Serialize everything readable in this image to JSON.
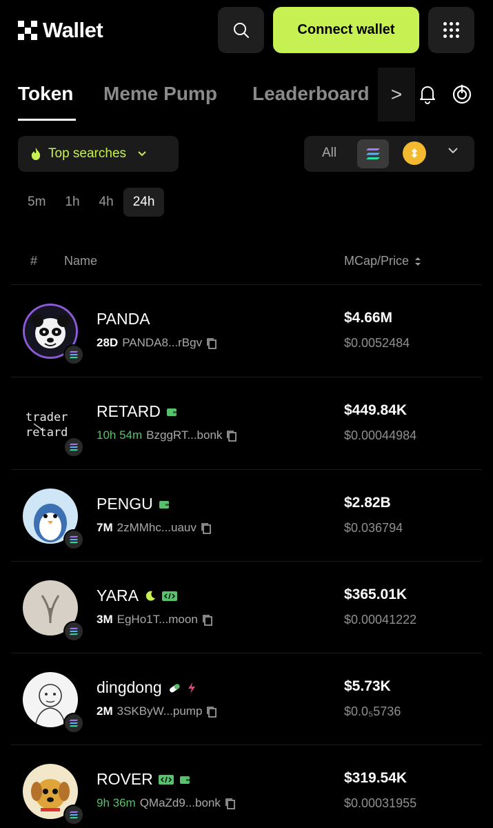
{
  "header": {
    "app_name": "Wallet",
    "connect_label": "Connect wallet",
    "icons": {
      "search": "search-icon",
      "menu": "grid-menu-icon"
    },
    "accent_color": "#c7f052"
  },
  "tabs": {
    "items": [
      {
        "label": "Token",
        "active": true
      },
      {
        "label": "Meme Pump",
        "active": false
      },
      {
        "label": "Leaderboard",
        "active": false
      }
    ],
    "more_label": ">"
  },
  "filters": {
    "top_searches_label": "Top searches",
    "chain_all_label": "All",
    "timeframes": [
      {
        "label": "5m",
        "active": false
      },
      {
        "label": "1h",
        "active": false
      },
      {
        "label": "4h",
        "active": false
      },
      {
        "label": "24h",
        "active": true
      }
    ]
  },
  "table": {
    "col_rank": "#",
    "col_name": "Name",
    "col_mcap": "MCap/Price",
    "rows": [
      {
        "name": "PANDA",
        "age": "28D",
        "address": "PANDA8...rBgv",
        "mcap": "$4.66M",
        "price": "$0.0052484",
        "age_green": false,
        "tags": []
      },
      {
        "name": "RETARD",
        "age": "10h 54m",
        "address": "BzggRT...bonk",
        "mcap": "$449.84K",
        "price": "$0.00044984",
        "age_green": true,
        "tags": [
          "wallet"
        ]
      },
      {
        "name": "PENGU",
        "age": "7M",
        "address": "2zMMhc...uauv",
        "mcap": "$2.82B",
        "price": "$0.036794",
        "age_green": false,
        "tags": [
          "wallet"
        ]
      },
      {
        "name": "YARA",
        "age": "3M",
        "address": "EgHo1T...moon",
        "mcap": "$365.01K",
        "price": "$0.00041222",
        "age_green": false,
        "tags": [
          "moon",
          "code"
        ]
      },
      {
        "name": "dingdong",
        "age": "2M",
        "address": "3SKByW...pump",
        "mcap": "$5.73K",
        "price": "$0.0₅5736",
        "age_green": false,
        "tags": [
          "pill",
          "bolt"
        ]
      },
      {
        "name": "ROVER",
        "age": "9h 36m",
        "address": "QMaZd9...bonk",
        "mcap": "$319.54K",
        "price": "$0.00031955",
        "age_green": true,
        "tags": [
          "code",
          "wallet"
        ]
      }
    ]
  }
}
